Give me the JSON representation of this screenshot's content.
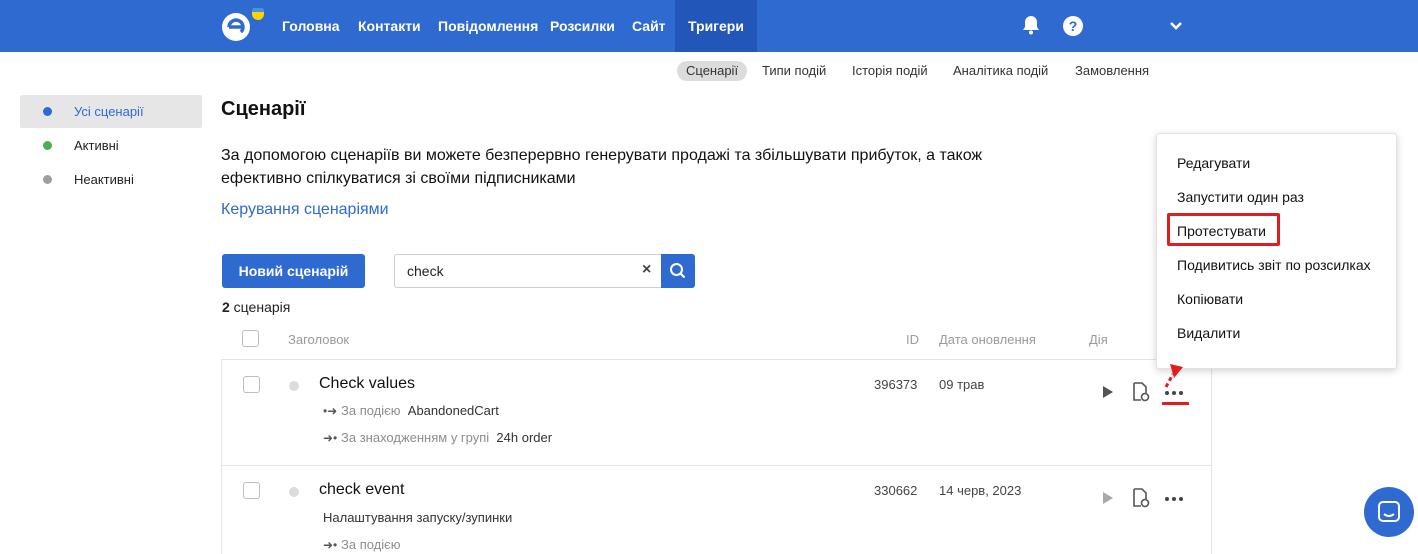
{
  "nav": {
    "items": [
      "Головна",
      "Контакти",
      "Повідомлення",
      "Розсилки",
      "Сайт",
      "Тригери"
    ],
    "help_label": "?"
  },
  "subnav": {
    "items": [
      "Сценарії",
      "Типи подій",
      "Історія подій",
      "Аналітика подій",
      "Замовлення"
    ]
  },
  "sidebar": {
    "items": [
      {
        "label": "Усі сценарії",
        "dot_color": "#2f6ad0"
      },
      {
        "label": "Активні",
        "dot_color": "#4caf50"
      },
      {
        "label": "Неактивні",
        "dot_color": "#9e9e9e"
      }
    ]
  },
  "main": {
    "title": "Сценарії",
    "description": "За допомогою сценаріїв ви можете безперервно генерувати продажі та збільшувати прибуток, а також ефективно спілкуватися зі своїми підписниками",
    "manage_link": "Керування сценаріями",
    "new_button": "Новий сценарій",
    "search_value": "check",
    "search_clear": "×",
    "count_number": "2",
    "count_label": " сценарія"
  },
  "table": {
    "headers": [
      "Заголовок",
      "ID",
      "Дата оновлення",
      "Дія"
    ],
    "rows": [
      {
        "title": "Check values",
        "id": "396373",
        "date": "09 трав",
        "lines": [
          {
            "muted": "За подією",
            "value": "AbandonedCart"
          },
          {
            "muted": "За знаходженням у групі",
            "value": "24h order"
          }
        ]
      },
      {
        "title": "check event",
        "id": "330662",
        "date": "14 черв, 2023",
        "setup": "Налаштування запуску/зупинки",
        "lines": [
          {
            "muted": "За подією",
            "value": ""
          }
        ]
      }
    ]
  },
  "dropdown": {
    "items": [
      "Редагувати",
      "Запустити один раз",
      "Протестувати",
      "Подивитись звіт по розсилках",
      "Копіювати",
      "Видалити"
    ]
  },
  "colors": {
    "primary": "#2f6ad0",
    "highlight": "#e21d1d"
  }
}
